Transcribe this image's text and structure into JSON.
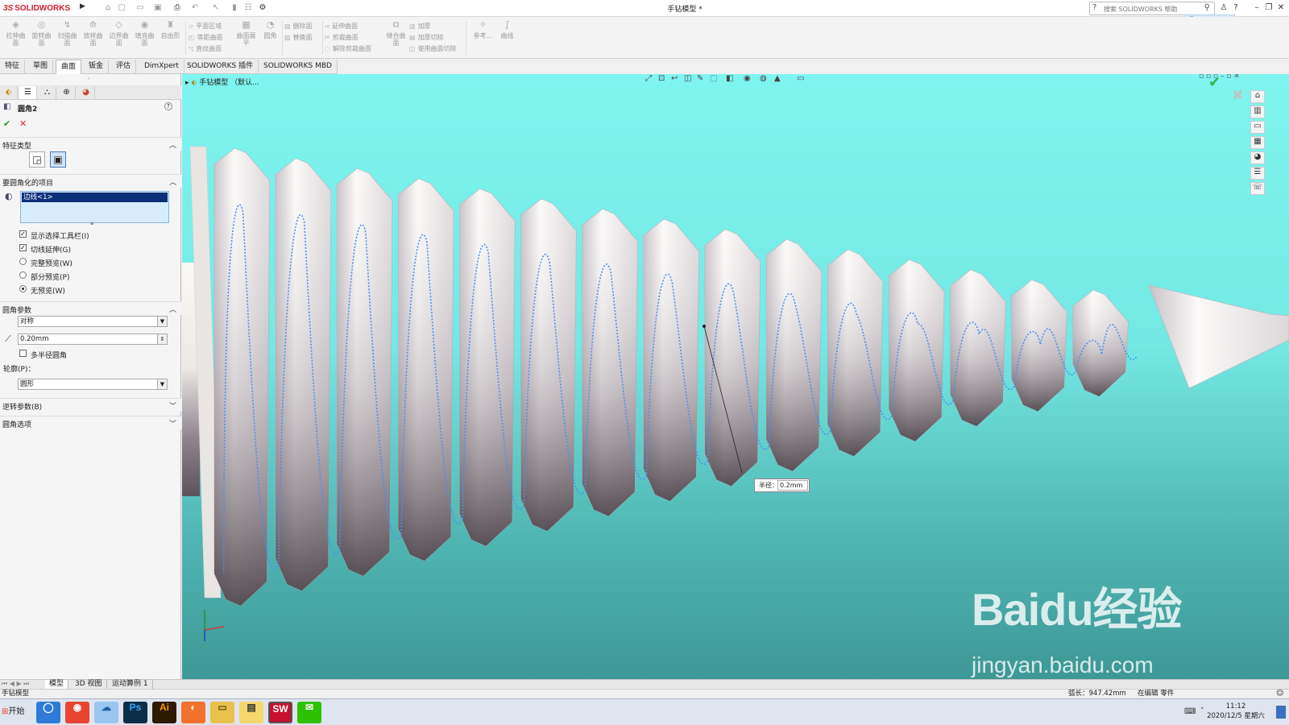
{
  "window": {
    "app_name": "SOLIDWORKS",
    "document_title": "手钻模型 *",
    "search_placeholder": "搜索 SOLIDWORKS 帮助"
  },
  "ribbon": {
    "large_buttons": [
      "拉伸曲面",
      "旋转曲面",
      "扫描曲面",
      "放样曲面",
      "边界曲面",
      "填充曲面",
      "自由形"
    ],
    "small_col1": [
      "平面区域",
      "等距曲面",
      "直纹曲面"
    ],
    "mid_button": "曲面展平",
    "round_button": "圆角",
    "small_col2": [
      "删除面",
      "替换面"
    ],
    "small_col3": [
      "延伸曲面",
      "剪裁曲面",
      "解除剪裁曲面"
    ],
    "knit_button": "缝合曲面",
    "small_col4": [
      "加厚",
      "加厚切除",
      "使用曲面切除"
    ],
    "ref_button": "参考...",
    "curve_button": "曲线"
  },
  "command_tabs": [
    "特征",
    "草图",
    "曲面",
    "钣金",
    "评估",
    "DimXpert",
    "SOLIDWORKS 插件",
    "SOLIDWORKS MBD"
  ],
  "command_tab_active": "曲面",
  "property_manager": {
    "title": "圆角2",
    "ok_label": "✔",
    "cancel_label": "✕",
    "sections": {
      "feature_type": "特征类型",
      "items_to_fillet": "要圆角化的项目",
      "fillet_params": "圆角参数",
      "setback_params": "逆转参数(B)",
      "fillet_options": "圆角选项"
    },
    "selected_edge": "边线<1>",
    "checkboxes": [
      {
        "label": "显示选择工具栏(I)",
        "checked": true
      },
      {
        "label": "切线延伸(G)",
        "checked": true
      }
    ],
    "radios": [
      {
        "label": "完整预览(W)",
        "selected": false
      },
      {
        "label": "部分预览(P)",
        "selected": false
      },
      {
        "label": "无预览(W)",
        "selected": true
      }
    ],
    "symmetry_select": "对称",
    "radius_value": "0.20mm",
    "multi_radius_label": "多半径圆角",
    "multi_radius_checked": false,
    "profile_label": "轮廓(P)：",
    "profile_select": "圆形"
  },
  "viewport": {
    "tree_flyout": "手钻模型 （默认...",
    "dimension_label": "半径：",
    "dimension_value": "0.2mm",
    "watermark_logo": "Baidu经验",
    "watermark_url": "jingyan.baidu.com",
    "background_top": "#7ff5f0",
    "background_bottom": "#3d9895",
    "edge_highlight_color": "#4a8ff0"
  },
  "bottom_tabs": [
    "模型",
    "3D 视图",
    "运动算例 1"
  ],
  "bottom_tab_active": "模型",
  "status": {
    "left": "手钻模型",
    "arc_length": "弧长：947.42mm",
    "editing": "在编辑 零件"
  },
  "taskbar": {
    "start_label": "开始",
    "apps": [
      "browser",
      "chrome",
      "baidu-netdisk",
      "Ps",
      "Ai",
      "firefox",
      "file-explorer",
      "notepad",
      "SW",
      "wechat"
    ],
    "clock_time": "11:12",
    "clock_date": "2020/12/5 星期六"
  }
}
